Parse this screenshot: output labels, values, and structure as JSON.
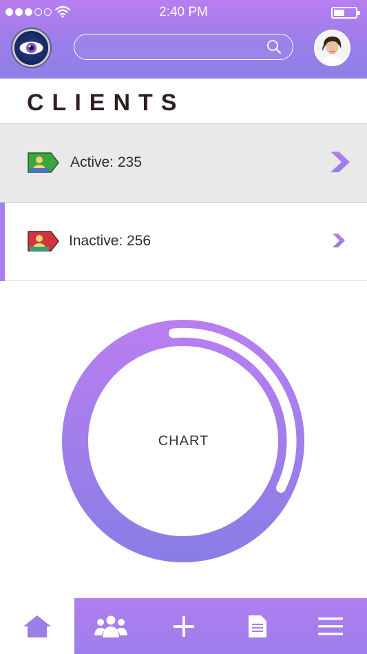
{
  "status_bar": {
    "time": "2:40 PM",
    "signal_icon": "signal-dots-icon",
    "wifi_icon": "wifi-icon",
    "battery_icon": "battery-icon"
  },
  "header": {
    "logo_icon": "eye-logo-icon",
    "search": {
      "value": "",
      "placeholder": "",
      "icon": "search-icon"
    },
    "avatar_icon": "user-avatar-icon"
  },
  "page": {
    "title": "CLIENTS"
  },
  "clients": [
    {
      "label": "Active:",
      "count": "235",
      "icon": "user-tag-icon",
      "tag_color": "#3aa83c",
      "selected": false
    },
    {
      "label": "Inactive:",
      "count": "256",
      "icon": "user-tag-icon",
      "tag_color": "#d0343f",
      "selected": true
    }
  ],
  "chart": {
    "label": "CHART",
    "ring_color_top": "#b87ef0",
    "ring_color_bottom": "#8a7ee6"
  },
  "tabbar": {
    "items": [
      {
        "icon": "home-icon",
        "active": true
      },
      {
        "icon": "users-icon",
        "active": false
      },
      {
        "icon": "plus-icon",
        "active": false
      },
      {
        "icon": "document-icon",
        "active": false
      },
      {
        "icon": "menu-icon",
        "active": false
      }
    ]
  },
  "colors": {
    "accent": "#a77ff0",
    "header_gradient_top": "#b87ef0",
    "header_gradient_bottom": "#8d80e6"
  }
}
